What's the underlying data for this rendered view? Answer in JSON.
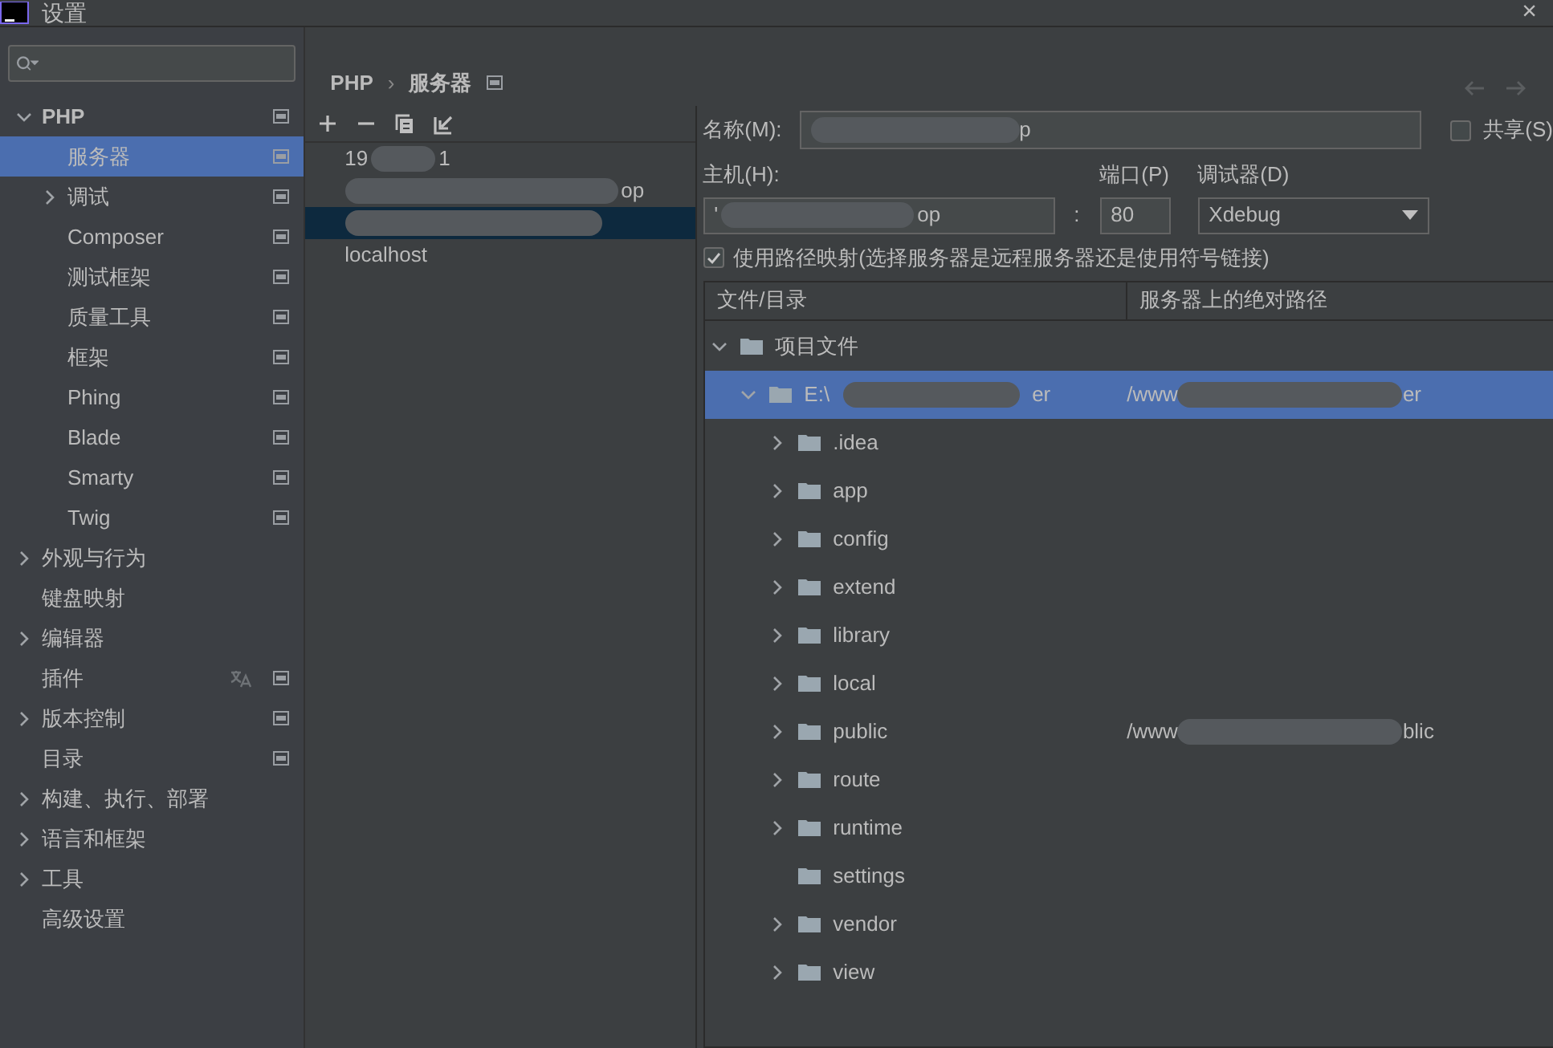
{
  "window": {
    "title": "设置",
    "close": "×"
  },
  "sidebar": {
    "items": [
      {
        "label": "PHP",
        "expanded": true,
        "selected": false,
        "page": true,
        "children": [
          {
            "label": "服务器",
            "selected": true,
            "page": true
          },
          {
            "label": "调试",
            "expanded": false,
            "selected": false,
            "page": true
          },
          {
            "label": "Composer",
            "selected": false,
            "page": true
          },
          {
            "label": "测试框架",
            "selected": false,
            "page": true
          },
          {
            "label": "质量工具",
            "selected": false,
            "page": true
          },
          {
            "label": "框架",
            "selected": false,
            "page": true
          },
          {
            "label": "Phing",
            "selected": false,
            "page": true
          },
          {
            "label": "Blade",
            "selected": false,
            "page": true
          },
          {
            "label": "Smarty",
            "selected": false,
            "page": true
          },
          {
            "label": "Twig",
            "selected": false,
            "page": true
          }
        ]
      },
      {
        "label": "外观与行为",
        "expanded": false,
        "selected": false
      },
      {
        "label": "键盘映射",
        "selected": false
      },
      {
        "label": "编辑器",
        "expanded": false,
        "selected": false
      },
      {
        "label": "插件",
        "selected": false,
        "translate": true,
        "page": true
      },
      {
        "label": "版本控制",
        "expanded": false,
        "selected": false,
        "page": true
      },
      {
        "label": "目录",
        "selected": false,
        "page": true
      },
      {
        "label": "构建、执行、部署",
        "expanded": false,
        "selected": false
      },
      {
        "label": "语言和框架",
        "expanded": false,
        "selected": false
      },
      {
        "label": "工具",
        "expanded": false,
        "selected": false
      },
      {
        "label": "高级设置",
        "selected": false
      }
    ]
  },
  "breadcrumb": [
    "PHP",
    "›",
    "服务器"
  ],
  "servers": [
    {
      "prefix": "19",
      "suffix": "1",
      "selected": false
    },
    {
      "suffix": "op",
      "selected": false
    },
    {
      "selected": true
    },
    {
      "prefix": "localhost",
      "selected": false
    }
  ],
  "form": {
    "name_label": "名称(M):",
    "name_value": "p",
    "shared_label": "共享(S)",
    "shared": false,
    "host_label": "主机(H):",
    "host_value": "op",
    "host_prefix": "'",
    "colon": ":",
    "port_label": "端口(P)",
    "port_value": "80",
    "debugger_label": "调试器(D)",
    "debugger_value": "Xdebug",
    "mapping_label": "使用路径映射(选择服务器是远程服务器还是使用符号链接)",
    "mapping": true
  },
  "table": {
    "columns": [
      "文件/目录",
      "服务器上的绝对路径"
    ],
    "rows": [
      {
        "name": "项目文件",
        "expanded": true,
        "selected": false,
        "children": [
          {
            "name": "E:\\",
            "name_end": "er",
            "path": "/www",
            "path_end": "er",
            "expanded": true,
            "selected": true,
            "children": [
              {
                "name": ".idea",
                "expanded": false,
                "selected": false
              },
              {
                "name": "app",
                "expanded": false,
                "selected": false
              },
              {
                "name": "config",
                "expanded": false,
                "selected": false
              },
              {
                "name": "extend",
                "expanded": false,
                "selected": false
              },
              {
                "name": "library",
                "expanded": false,
                "selected": false
              },
              {
                "name": "local",
                "expanded": false,
                "selected": false
              },
              {
                "name": "public",
                "path": "/www",
                "path_end": "blic",
                "expanded": false,
                "selected": false
              },
              {
                "name": "route",
                "expanded": false,
                "selected": false
              },
              {
                "name": "runtime",
                "expanded": false,
                "selected": false
              },
              {
                "name": "settings",
                "selected": false
              },
              {
                "name": "vendor",
                "expanded": false,
                "selected": false
              },
              {
                "name": "view",
                "expanded": false,
                "selected": false
              }
            ]
          }
        ]
      }
    ]
  }
}
